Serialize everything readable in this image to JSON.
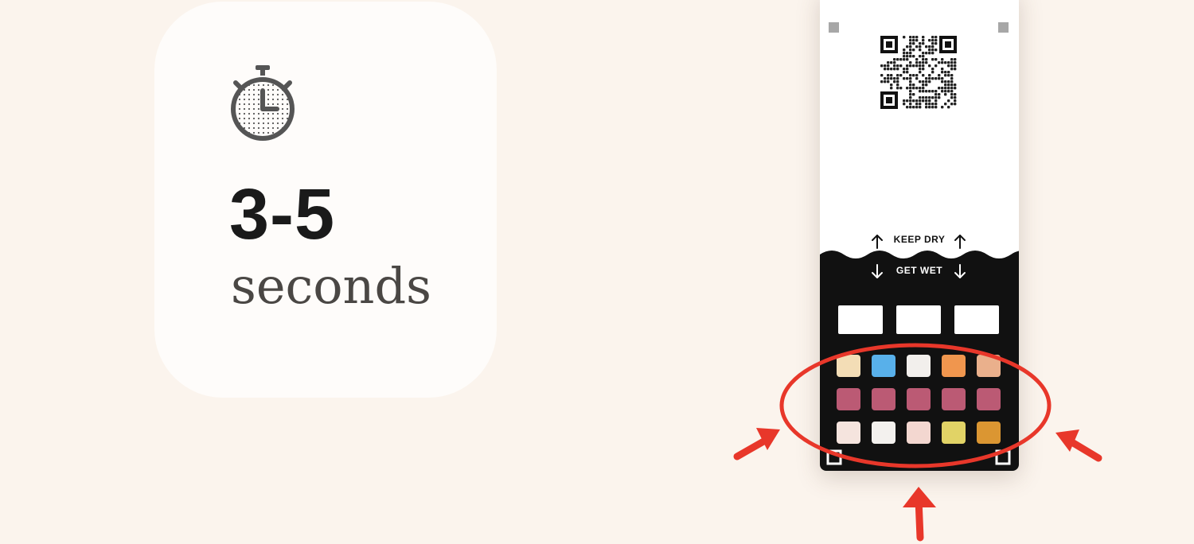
{
  "timer_card": {
    "value": "3-5",
    "unit": "seconds",
    "icon": "stopwatch-icon"
  },
  "strip": {
    "keep_dry_label": "KEEP DRY",
    "get_wet_label": "GET WET",
    "qr_icon": "qr-code-icon",
    "pad_colors": [
      [
        "#f3ddb6",
        "#58b0ea",
        "#f2efec",
        "#f0964e",
        "#eab08c"
      ],
      [
        "#bb5a74",
        "#bb5a74",
        "#bb5a74",
        "#bb5a74",
        "#bb5a74"
      ],
      [
        "#f5e4de",
        "#f3f1ee",
        "#f3d7d0",
        "#e1d366",
        "#db9632"
      ]
    ]
  },
  "annotation": {
    "color": "#e8372a",
    "shape": "ellipse-with-three-arrows"
  }
}
